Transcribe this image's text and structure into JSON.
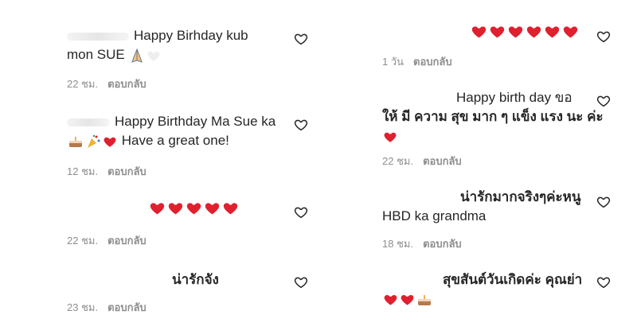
{
  "comments_left": [
    {
      "line1": "Happy Birhday kub",
      "line2": "mon SUE",
      "emoji2": [
        "pray-icon",
        "white-heart-icon"
      ],
      "time": "22 ชม.",
      "reply": "ตอบกลับ"
    },
    {
      "line1": "Happy Birthday Ma Sue ka",
      "line2": "Have a great one!",
      "emoji2": [
        "cake-icon",
        "party-popper-icon",
        "red-heart-icon"
      ],
      "time": "12 ชม.",
      "reply": "ตอบกลับ"
    },
    {
      "emoji1": [
        "red-heart-icon",
        "red-heart-icon",
        "red-heart-icon",
        "red-heart-icon",
        "red-heart-icon"
      ],
      "time": "22 ชม.",
      "reply": "ตอบกลับ"
    },
    {
      "line1": "น่ารักจัง",
      "time": "23 ชม.",
      "reply": "ตอบกลับ"
    }
  ],
  "comments_right": [
    {
      "emoji1": [
        "red-heart-icon",
        "red-heart-icon",
        "red-heart-icon",
        "red-heart-icon",
        "red-heart-icon",
        "red-heart-icon"
      ],
      "time": "1 วัน",
      "reply": "ตอบกลับ"
    },
    {
      "line1": "Happy birth day ขอ",
      "line2": "ให้ มี ความ สุข มาก ๆ แข็ง แรง นะ ค่ะ",
      "emoji3": [
        "red-heart-icon"
      ],
      "time": "22 ชม.",
      "reply": "ตอบกลับ"
    },
    {
      "line1": "น่ารักมากจริงๆค่ะหนู",
      "line2": "HBD ka grandma",
      "time": "18 ชม.",
      "reply": "ตอบกลับ"
    },
    {
      "line1": "สุขสันต์วันเกิดค่ะ คุณย่า",
      "emoji2": [
        "red-heart-icon",
        "red-heart-icon",
        "cake-icon"
      ],
      "time": "",
      "reply": ""
    }
  ],
  "colors": {
    "text": "#262626",
    "meta": "#8e8e8e",
    "heart": "#e0202e",
    "outline": "#262626"
  }
}
